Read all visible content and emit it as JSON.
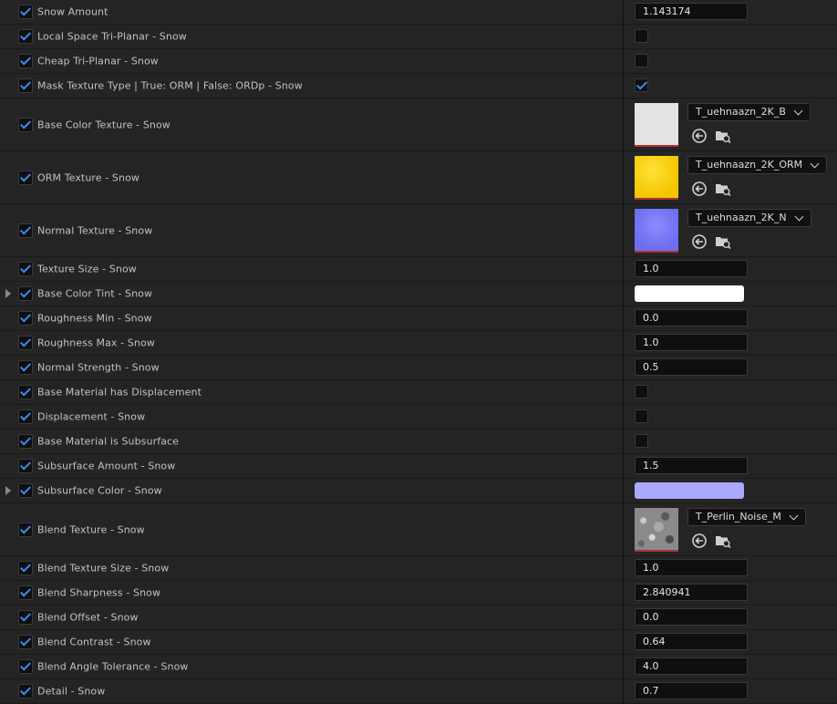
{
  "rows": [
    {
      "label": "Snow Amount",
      "type": "number",
      "value": "1.143174",
      "enabled": true
    },
    {
      "label": "Local Space Tri-Planar - Snow",
      "type": "bool",
      "checked": false,
      "enabled": true
    },
    {
      "label": "Cheap Tri-Planar - Snow",
      "type": "bool",
      "checked": false,
      "enabled": true
    },
    {
      "label": "Mask Texture Type | True: ORM | False: ORDp - Snow",
      "type": "bool",
      "checked": true,
      "enabled": true
    },
    {
      "label": "Base Color Texture - Snow",
      "type": "texture",
      "asset": "T_uehnaazn_2K_B",
      "thumb": "base",
      "enabled": true
    },
    {
      "label": "ORM Texture - Snow",
      "type": "texture",
      "asset": "T_uehnaazn_2K_ORM",
      "thumb": "orm",
      "enabled": true
    },
    {
      "label": "Normal Texture  - Snow",
      "type": "texture",
      "asset": "T_uehnaazn_2K_N",
      "thumb": "nrm",
      "enabled": true
    },
    {
      "label": "Texture Size - Snow",
      "type": "number",
      "value": "1.0",
      "enabled": true
    },
    {
      "label": "Base Color Tint - Snow",
      "type": "color",
      "color": "#ffffff",
      "expandable": true,
      "enabled": true
    },
    {
      "label": "Roughness Min - Snow",
      "type": "number",
      "value": "0.0",
      "enabled": true
    },
    {
      "label": "Roughness Max - Snow",
      "type": "number",
      "value": "1.0",
      "enabled": true
    },
    {
      "label": "Normal Strength - Snow",
      "type": "number",
      "value": "0.5",
      "enabled": true
    },
    {
      "label": "Base Material has Displacement",
      "type": "bool",
      "checked": false,
      "enabled": true
    },
    {
      "label": "Displacement - Snow",
      "type": "bool",
      "checked": false,
      "enabled": true
    },
    {
      "label": "Base Material is Subsurface",
      "type": "bool",
      "checked": false,
      "enabled": true
    },
    {
      "label": "Subsurface Amount - Snow",
      "type": "number",
      "value": "1.5",
      "enabled": true
    },
    {
      "label": "Subsurface Color - Snow",
      "type": "color",
      "color": "#aaa8ff",
      "expandable": true,
      "enabled": true
    },
    {
      "label": "Blend Texture - Snow",
      "type": "texture",
      "asset": "T_Perlin_Noise_M",
      "thumb": "noise",
      "enabled": true
    },
    {
      "label": "Blend Texture Size - Snow",
      "type": "number",
      "value": "1.0",
      "enabled": true
    },
    {
      "label": "Blend Sharpness - Snow",
      "type": "number",
      "value": "2.840941",
      "enabled": true
    },
    {
      "label": "Blend Offset - Snow",
      "type": "number",
      "value": "0.0",
      "enabled": true
    },
    {
      "label": "Blend Contrast - Snow",
      "type": "number",
      "value": "0.64",
      "enabled": true
    },
    {
      "label": "Blend Angle Tolerance - Snow",
      "type": "number",
      "value": "4.0",
      "enabled": true
    },
    {
      "label": "Detail - Snow",
      "type": "number",
      "value": "0.7",
      "enabled": true
    }
  ],
  "colors": {
    "accent_check": "#3d8bf0",
    "row_bg": "#242424",
    "field_bg": "#0f0f0f"
  },
  "icons": {
    "use_selected": "arrow-left-circle-icon",
    "browse": "folder-search-icon"
  }
}
